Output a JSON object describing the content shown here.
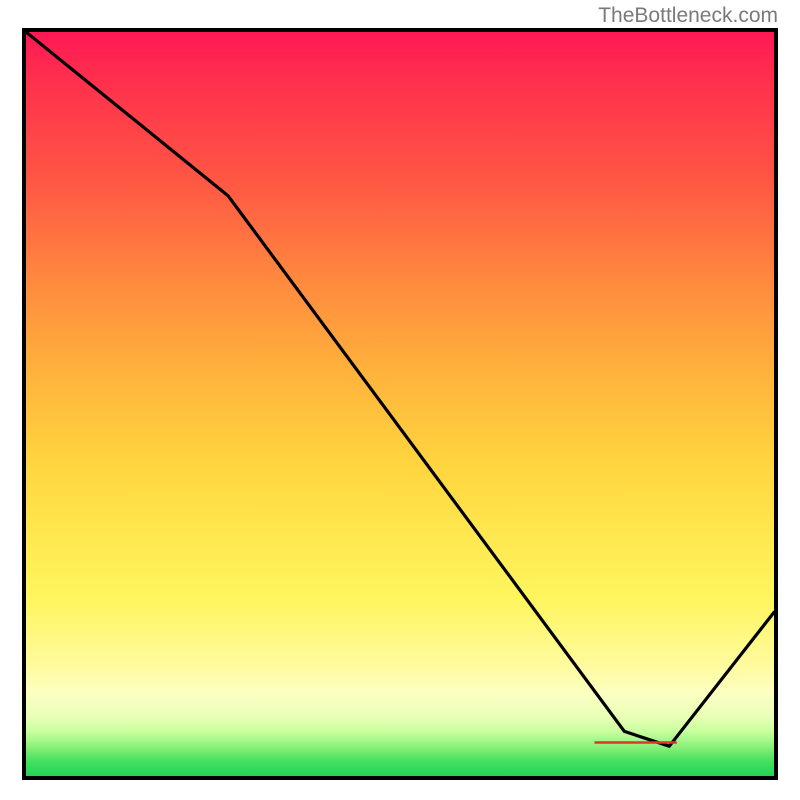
{
  "watermark": "TheBottleneck.com",
  "chart_data": {
    "type": "line",
    "title": "",
    "xlabel": "",
    "ylabel": "",
    "xlim": [
      0,
      100
    ],
    "ylim": [
      0,
      100
    ],
    "series": [
      {
        "name": "bottleneck-curve",
        "x": [
          0,
          27,
          80,
          86,
          100
        ],
        "values": [
          100,
          78,
          6,
          4,
          22
        ]
      }
    ],
    "annotations": [
      {
        "name": "highlight-segment",
        "x0": 76,
        "x1": 87,
        "y": 4.5
      }
    ]
  },
  "colors": {
    "line": "#000000",
    "marker": "#d83a2a"
  }
}
